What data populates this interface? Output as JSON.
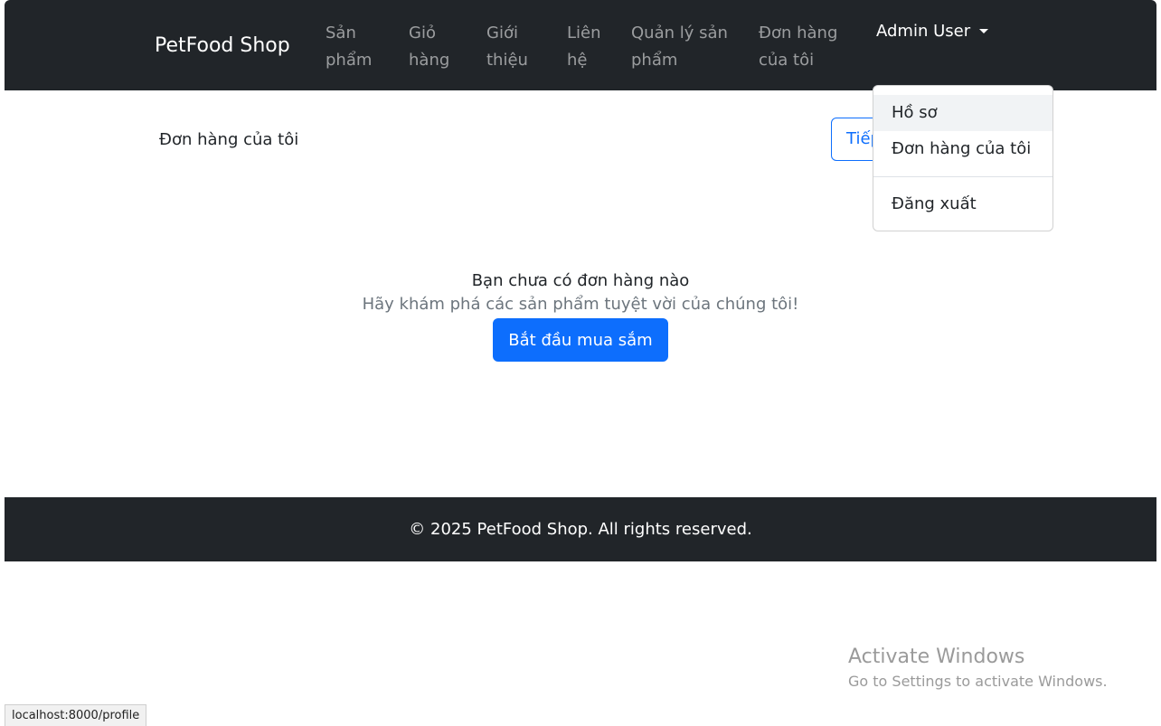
{
  "navbar": {
    "brand": "PetFood Shop",
    "links": [
      {
        "line1": "Sản",
        "line2": "phẩm"
      },
      {
        "line1": "Giỏ",
        "line2": "hàng"
      },
      {
        "line1": "Giới",
        "line2": "thiệu"
      },
      {
        "line1": "Liên",
        "line2": "hệ"
      },
      {
        "line1": "Quản lý sản",
        "line2": "phẩm"
      },
      {
        "line1": "Đơn hàng",
        "line2": "của tôi"
      }
    ],
    "user_label": "Admin User"
  },
  "dropdown": {
    "items": [
      "Hồ sơ",
      "Đơn hàng của tôi",
      "Đăng xuất"
    ]
  },
  "main": {
    "heading": "Đơn hàng của tôi",
    "continue_label": "Tiếp tục mua sắm",
    "empty_title": "Bạn chưa có đơn hàng nào",
    "empty_subtitle": "Hãy khám phá các sản phẩm tuyệt vời của chúng tôi!",
    "start_button": "Bắt đầu mua sắm"
  },
  "footer": {
    "text": "© 2025 PetFood Shop. All rights reserved."
  },
  "watermark": {
    "title": "Activate Windows",
    "subtitle": "Go to Settings to activate Windows."
  },
  "status_bar": {
    "url": "localhost:8000/profile"
  }
}
